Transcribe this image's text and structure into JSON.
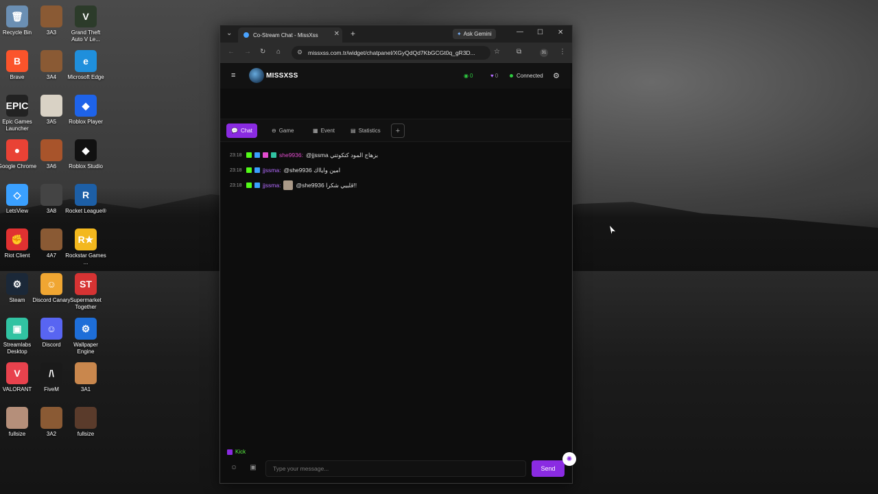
{
  "desktop": {
    "icons": [
      {
        "label": "Recycle Bin",
        "glyph": "🗑",
        "color": "#6b8fb3"
      },
      {
        "label": "3A3",
        "glyph": "",
        "color": "#8a5a34"
      },
      {
        "label": "Grand Theft Auto V Le...",
        "glyph": "V",
        "color": "#2c3b2a"
      },
      {
        "label": "Brave",
        "glyph": "B",
        "color": "#fb542b"
      },
      {
        "label": "3A4",
        "glyph": "",
        "color": "#8a5a34"
      },
      {
        "label": "Microsoft Edge",
        "glyph": "e",
        "color": "#1f8fdc"
      },
      {
        "label": "Epic Games Launcher",
        "glyph": "EPIC",
        "color": "#222"
      },
      {
        "label": "3A5",
        "glyph": "",
        "color": "#d9d2c5"
      },
      {
        "label": "Roblox Player",
        "glyph": "◆",
        "color": "#1e63e9"
      },
      {
        "label": "Google Chrome",
        "glyph": "●",
        "color": "#e94235"
      },
      {
        "label": "3A6",
        "glyph": "",
        "color": "#a8542b"
      },
      {
        "label": "Roblox Studio",
        "glyph": "◆",
        "color": "#111"
      },
      {
        "label": "LetsView",
        "glyph": "◇",
        "color": "#3aa0ff"
      },
      {
        "label": "3A8",
        "glyph": "",
        "color": "#444"
      },
      {
        "label": "Rocket League®",
        "glyph": "R",
        "color": "#1d5fa6"
      },
      {
        "label": "Riot Client",
        "glyph": "✊",
        "color": "#e03131"
      },
      {
        "label": "4A7",
        "glyph": "",
        "color": "#8a5a34"
      },
      {
        "label": "Rockstar Games ...",
        "glyph": "R★",
        "color": "#f3b81e"
      },
      {
        "label": "Steam",
        "glyph": "⚙",
        "color": "#1b2838"
      },
      {
        "label": "Discord Canary",
        "glyph": "☺",
        "color": "#f0a632"
      },
      {
        "label": "Supermarket Together",
        "glyph": "ST",
        "color": "#d63333"
      },
      {
        "label": "Streamlabs Desktop",
        "glyph": "▣",
        "color": "#31c3a2"
      },
      {
        "label": "Discord",
        "glyph": "☺",
        "color": "#5865f2"
      },
      {
        "label": "Wallpaper Engine",
        "glyph": "⚙",
        "color": "#1e6ed8"
      },
      {
        "label": "VALORANT",
        "glyph": "V",
        "color": "#e8424d"
      },
      {
        "label": "FiveM",
        "glyph": "/\\",
        "color": "#1a1a1a"
      },
      {
        "label": "3A1",
        "glyph": "",
        "color": "#c9874d"
      },
      {
        "label": "fullsize",
        "glyph": "",
        "color": "#b58f7a"
      },
      {
        "label": "3A2",
        "glyph": "",
        "color": "#8a5a34"
      },
      {
        "label": "fullsize",
        "glyph": "",
        "color": "#5a3b2b"
      }
    ]
  },
  "browser": {
    "tab_title": "Co-Stream Chat - MissXss",
    "ask_gemini": "Ask Gemini",
    "url": "missxss.com.tr/widget/chatpanel/XGyQdQd7KbGCGt0q_gR3D...",
    "profile_badge": "31"
  },
  "app": {
    "brand": "MISSXSS",
    "viewers": "0",
    "likes": "0",
    "status": "Connected",
    "tabs": [
      {
        "label": "Chat",
        "icon": "chat-icon"
      },
      {
        "label": "Game",
        "icon": "gamepad-icon"
      },
      {
        "label": "Event",
        "icon": "calendar-icon"
      },
      {
        "label": "Statistics",
        "icon": "chart-icon"
      }
    ],
    "messages": [
      {
        "time": "23:18",
        "user": "she9936:",
        "user_color": "#e34ccf",
        "text": "@jjssma بزهاج المود كتكوتتي"
      },
      {
        "time": "23:18",
        "user": "jjssma:",
        "user_color": "#b36bff",
        "text": "@she9936 امين وايااك"
      },
      {
        "time": "23:18",
        "user": "jjssma:",
        "user_color": "#b36bff",
        "text": "@she9936 قلبيي شكرا!!"
      }
    ],
    "kick_label": "Kick",
    "input_placeholder": "Type your message...",
    "send_label": "Send"
  },
  "colors": {
    "accent": "#8a2be2",
    "kick_green": "#53fc18",
    "connected": "#2ecc40"
  }
}
